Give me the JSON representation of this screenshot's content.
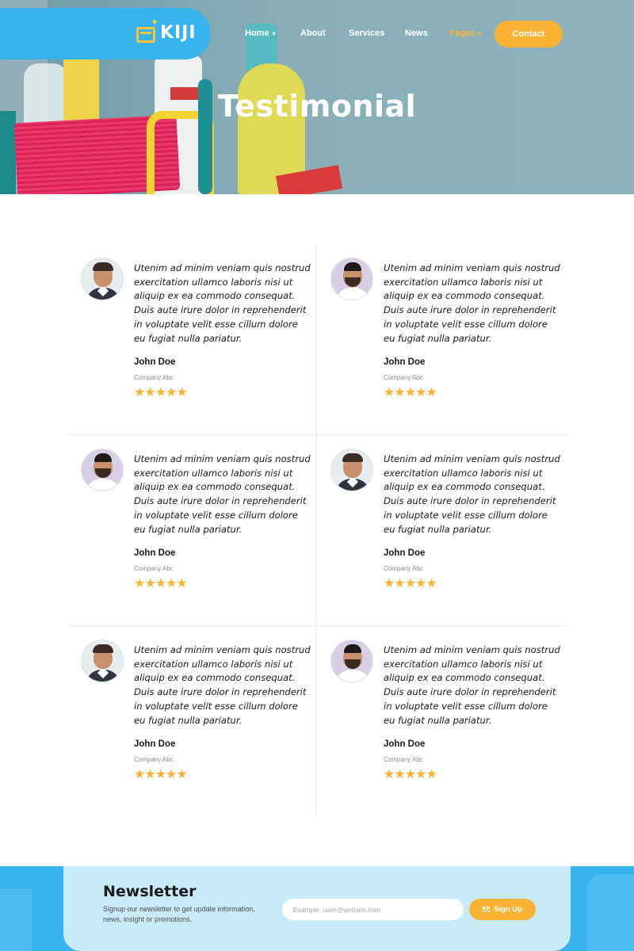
{
  "brand": {
    "logo_text": "KIJI"
  },
  "nav": {
    "items": [
      {
        "label": "Home",
        "has_caret": true,
        "active": false
      },
      {
        "label": "About",
        "has_caret": false,
        "active": false
      },
      {
        "label": "Services",
        "has_caret": false,
        "active": false
      },
      {
        "label": "News",
        "has_caret": false,
        "active": false
      },
      {
        "label": "Pages",
        "has_caret": true,
        "active": true
      }
    ],
    "contact_label": "Contact"
  },
  "hero": {
    "title": "Testimonial"
  },
  "testimonials": [
    {
      "quote": "Utenim ad minim veniam quis nostrud exercitation ullamco laboris nisi ut aliquip ex ea commodo consequat. Duis aute irure dolor in reprehenderit in voluptate velit esse cillum dolore eu fugiat nulla pariatur.",
      "name": "John Doe",
      "company": "Company Abc",
      "stars": "★★★★★",
      "rating": 5
    },
    {
      "quote": "Utenim ad minim veniam quis nostrud exercitation ullamco laboris nisi ut aliquip ex ea commodo consequat. Duis aute irure dolor in reprehenderit in voluptate velit esse cillum dolore eu fugiat nulla pariatur.",
      "name": "John Doe",
      "company": "Company Abc",
      "stars": "★★★★★",
      "rating": 5
    },
    {
      "quote": "Utenim ad minim veniam quis nostrud exercitation ullamco laboris nisi ut aliquip ex ea commodo consequat. Duis aute irure dolor in reprehenderit in voluptate velit esse cillum dolore eu fugiat nulla pariatur.",
      "name": "John Doe",
      "company": "Company Abc",
      "stars": "★★★★★",
      "rating": 5
    },
    {
      "quote": "Utenim ad minim veniam quis nostrud exercitation ullamco laboris nisi ut aliquip ex ea commodo consequat. Duis aute irure dolor in reprehenderit in voluptate velit esse cillum dolore eu fugiat nulla pariatur.",
      "name": "John Doe",
      "company": "Company Abc",
      "stars": "★★★★★",
      "rating": 5
    },
    {
      "quote": "Utenim ad minim veniam quis nostrud exercitation ullamco laboris nisi ut aliquip ex ea commodo consequat. Duis aute irure dolor in reprehenderit in voluptate velit esse cillum dolore eu fugiat nulla pariatur.",
      "name": "John Doe",
      "company": "Company Abc",
      "stars": "★★★★★",
      "rating": 5
    },
    {
      "quote": "Utenim ad minim veniam quis nostrud exercitation ullamco laboris nisi ut aliquip ex ea commodo consequat. Duis aute irure dolor in reprehenderit in voluptate velit esse cillum dolore eu fugiat nulla pariatur.",
      "name": "John Doe",
      "company": "Company Abc",
      "stars": "★★★★★",
      "rating": 5
    }
  ],
  "newsletter": {
    "title": "Newsletter",
    "description": "Signup our newsletter to get update information, news, insight or promotions.",
    "input_placeholder": "Example: user@website.com",
    "button_label": "Sign Up"
  },
  "colors": {
    "primary_blue": "#38b3ee",
    "accent_orange": "#f9b233",
    "newsletter_card": "#c9eaf8"
  },
  "icons": {
    "caret": "chevron-down-icon",
    "star": "star-icon",
    "mail": "envelope-icon"
  }
}
